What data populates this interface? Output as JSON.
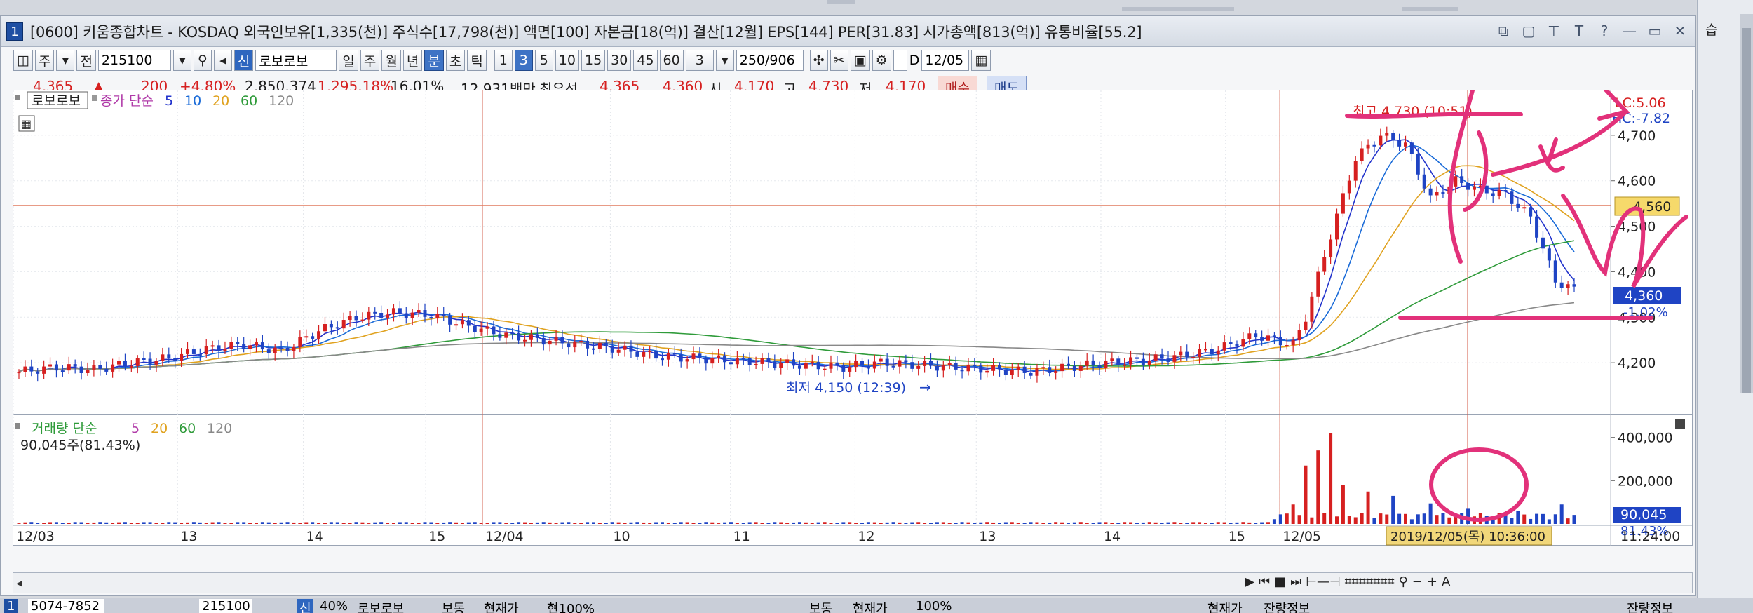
{
  "window": {
    "badge": "1",
    "title": "[0600] 키움종합차트 - KOSDAQ 외국인보유[1,335(천)] 주식수[17,798(천)] 액면[100] 자본금[18(억)] 결산[12월] EPS[144] PER[31.83] 시가총액[813(억)] 유통비율[55.2]"
  },
  "toolbar": {
    "market": "주",
    "prefix": "전",
    "code": "215100",
    "sin_badge": "신",
    "stock_name": "로보로보",
    "periods": [
      "일",
      "주",
      "월",
      "년",
      "분",
      "초",
      "틱"
    ],
    "selected_period": "분",
    "intervals": [
      "1",
      "3",
      "5",
      "10",
      "15",
      "30",
      "45",
      "60"
    ],
    "selected_interval": "3",
    "interval_value": "3",
    "count": "250",
    "count_total": "/906",
    "d_label": "D",
    "date": "12/05"
  },
  "quote": {
    "price": "4,365",
    "arrow": "▲",
    "change": "200",
    "change_pct": "+4.80%",
    "volume": "2,850,374",
    "volume_ratio": "1,295.18%",
    "turnover": "16.01%",
    "amount": "12,931백만",
    "best_label": "최우선",
    "best_ask": "4,365",
    "best_bid": "4,360",
    "open_label": "시",
    "open": "4,170",
    "high_label": "고",
    "high": "4,730",
    "low_label": "저",
    "low": "4,170",
    "buy": "매수",
    "sell": "매도"
  },
  "price_panel": {
    "stock_tag": "로보로보",
    "legend_prefix": "종가 단순",
    "ma_periods": [
      "5",
      "10",
      "20",
      "60",
      "120"
    ],
    "ma_colors": [
      "#2233cc",
      "#1a6bd8",
      "#e0a21f",
      "#2f9b3a",
      "#888888"
    ],
    "high_note": "최고 4,730 (10:51)",
    "low_note": "최저 4,150 (12:39)",
    "lc": "LC:5.06",
    "hc": "HC:-7.82",
    "y_ticks": [
      "4,700",
      "4,600",
      "4,500",
      "4,400",
      "4,300",
      "4,200"
    ],
    "tag_ref": "4,560",
    "tag_current": "4,360",
    "tag_current_pct": "-1.02%"
  },
  "volume_panel": {
    "legend_name": "거래량 단순",
    "ma_periods": [
      "5",
      "20",
      "60",
      "120"
    ],
    "summary": "90,045주(81.43%)",
    "y_ticks": [
      "400,000",
      "200,000"
    ],
    "tag_current": "90,045",
    "tag_current_pct": "81.43%"
  },
  "x_axis": {
    "labels": [
      "12/03",
      "13",
      "14",
      "15",
      "12/04",
      "10",
      "11",
      "12",
      "13",
      "14",
      "15",
      "12/05"
    ],
    "crosshair_label": "2019/12/05(목) 10:36:00",
    "end_time": "11:24:00"
  },
  "chart_data": {
    "type": "candlestick",
    "y_range": [
      4120,
      4780
    ],
    "volume_range": [
      0,
      480000
    ],
    "price_line_indices": [
      0,
      6,
      12,
      18,
      24,
      30,
      36,
      42,
      48,
      54,
      60,
      66,
      72,
      78,
      84,
      90,
      96,
      102,
      108,
      114,
      120,
      126,
      132,
      138,
      144,
      150,
      156,
      162,
      168,
      174,
      180,
      186,
      192,
      198,
      204,
      206,
      210,
      214,
      218,
      222,
      226,
      230,
      234,
      238,
      242,
      246,
      249
    ],
    "closes": [
      4180,
      4190,
      4185,
      4200,
      4210,
      4230,
      4240,
      4225,
      4270,
      4300,
      4310,
      4305,
      4280,
      4260,
      4250,
      4240,
      4230,
      4215,
      4210,
      4205,
      4200,
      4195,
      4190,
      4200,
      4195,
      4190,
      4185,
      4180,
      4190,
      4200,
      4205,
      4215,
      4230,
      4260,
      4240,
      4300,
      4480,
      4650,
      4700,
      4680,
      4560,
      4600,
      4580,
      4570,
      4520,
      4380,
      4360
    ],
    "volume_spikes": [
      {
        "index": 204,
        "value": 90000
      },
      {
        "index": 206,
        "value": 270000
      },
      {
        "index": 208,
        "value": 340000
      },
      {
        "index": 210,
        "value": 420000
      },
      {
        "index": 212,
        "value": 180000
      },
      {
        "index": 216,
        "value": 150000
      },
      {
        "index": 220,
        "value": 130000
      },
      {
        "index": 226,
        "value": 95000
      },
      {
        "index": 232,
        "value": 70000
      },
      {
        "index": 240,
        "value": 60000
      },
      {
        "index": 247,
        "value": 90045
      }
    ]
  },
  "bottom": {
    "left_code": "5074-7852",
    "mid_code": "215100",
    "sin": "신",
    "pct": "40%",
    "name": "로보로보",
    "t1": "보통",
    "t2": "현재가",
    "t3": "현100%",
    "t4": "보통",
    "t5": "현재가",
    "t6": "100%",
    "t7": "현재가",
    "t8": "잔량정보",
    "t9": "잔량정보"
  },
  "side": {
    "label": "습"
  }
}
